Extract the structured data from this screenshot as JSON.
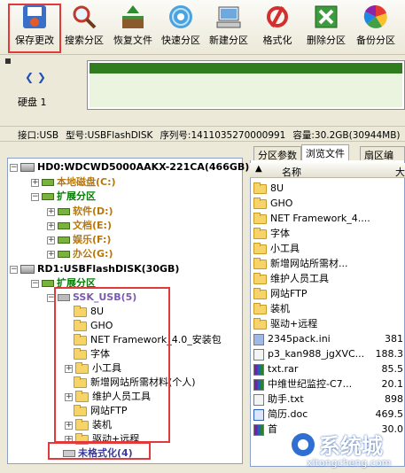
{
  "toolbar": [
    {
      "label": "保存更改",
      "icon": "save-icon"
    },
    {
      "label": "搜索分区",
      "icon": "magnifier-icon"
    },
    {
      "label": "恢复文件",
      "icon": "restore-icon"
    },
    {
      "label": "快速分区",
      "icon": "disc-icon"
    },
    {
      "label": "新建分区",
      "icon": "computer-icon"
    },
    {
      "label": "格式化",
      "icon": "format-icon"
    },
    {
      "label": "删除分区",
      "icon": "delete-icon"
    },
    {
      "label": "备份分区",
      "icon": "backup-icon"
    }
  ],
  "disk": {
    "label": "硬盘 1",
    "info": [
      "接口:USB",
      "型号:USBFlashDISK",
      "序列号:1411035270000991",
      "容量:30.2GB(30944MB)"
    ]
  },
  "tree": {
    "hd0": "HD0:WDCWD5000AAKX-221CA(466GB)",
    "hd0_items": [
      "本地磁盘(C:)",
      "扩展分区",
      "软件(D:)",
      "文档(E:)",
      "娱乐(F:)",
      "办公(G:)"
    ],
    "rd1": "RD1:USBFlashDISK(30GB)",
    "rd1_ext": "扩展分区",
    "ssk": "SSK_USB(5)",
    "folders": [
      "8U",
      "GHO",
      "NET Framework_4.0_安装包",
      "字体",
      "小工具",
      "新增网站所需材料(个人)",
      "维护人员工具",
      "网站FTP",
      "装机",
      "驱动+远程"
    ],
    "unformatted": "未格式化(4)"
  },
  "right": {
    "tabs": [
      "分区参数",
      "浏览文件",
      "扇区编辑"
    ],
    "col_name": "名称",
    "col_size": "大",
    "folders": [
      "8U",
      "GHO",
      "NET Framework_4....",
      "字体",
      "小工具",
      "新增网站所需材...",
      "维护人员工具",
      "网站FTP",
      "装机",
      "驱动+远程"
    ],
    "files": [
      {
        "name": "2345pack.ini",
        "size": "381"
      },
      {
        "name": "p3_kan988_jgXVC...",
        "size": "188.3"
      },
      {
        "name": "txt.rar",
        "size": "85.5"
      },
      {
        "name": "中维世纪监控-C7...",
        "size": "20.1"
      },
      {
        "name": "助手.txt",
        "size": "898"
      },
      {
        "name": "简历.doc",
        "size": "469.5"
      },
      {
        "name": "首",
        "size": "30.0"
      }
    ]
  },
  "watermark": {
    "text": "系统城",
    "url": "xitongcheng.com"
  }
}
